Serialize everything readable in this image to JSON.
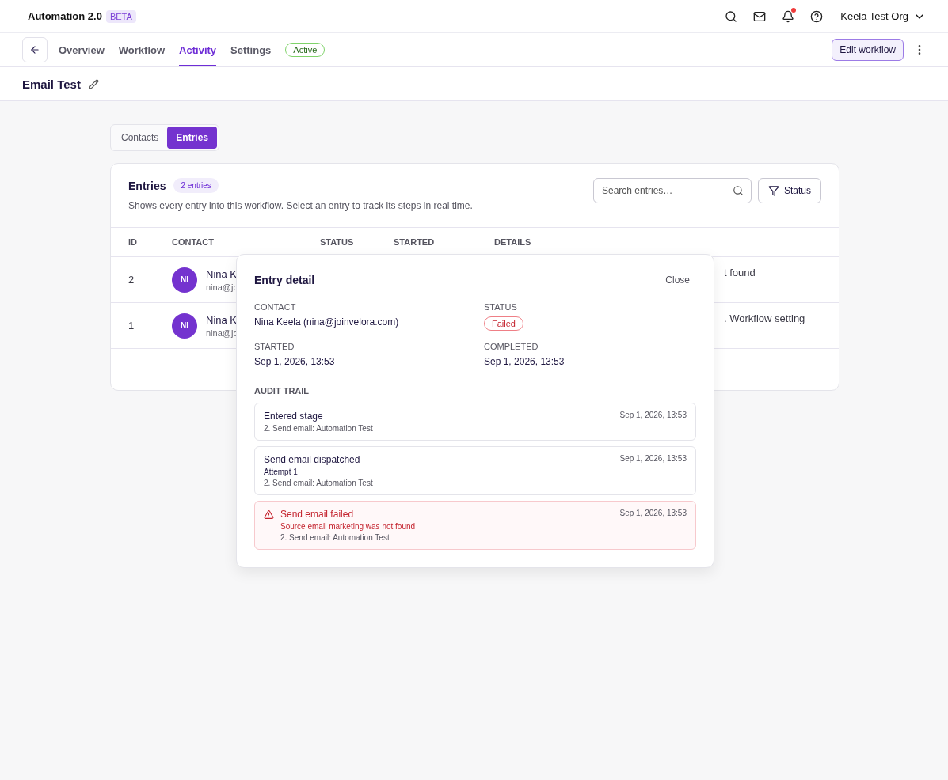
{
  "app": {
    "title": "Automation 2.0",
    "badge": "BETA",
    "org": "Keela Test Org",
    "has_notification": true
  },
  "nav": {
    "tabs": [
      {
        "label": "Overview",
        "selected": false
      },
      {
        "label": "Workflow",
        "selected": false
      },
      {
        "label": "Activity",
        "selected": true
      },
      {
        "label": "Settings",
        "selected": false
      }
    ],
    "status": "Active",
    "edit_button": "Edit workflow"
  },
  "page_title": "Email Test",
  "segments": [
    {
      "label": "Contacts",
      "selected": false
    },
    {
      "label": "Entries",
      "selected": true
    }
  ],
  "entries": {
    "title": "Entries",
    "count": "2 entries",
    "description": "Shows every entry into this workflow. Select an entry to track its steps in real time.",
    "search": {
      "placeholder": "Search entries…"
    },
    "filter_button": "Status",
    "columns": [
      "ID",
      "CONTACT",
      "STATUS",
      "STARTED",
      "DETAILS"
    ],
    "rows": [
      {
        "id": "2",
        "initials": "NI",
        "name": "Nina K",
        "email": "nina@jo",
        "details": "t found"
      },
      {
        "id": "1",
        "initials": "NI",
        "name": "Nina K",
        "email": "nina@jo",
        "details": ". Workflow setting"
      }
    ]
  },
  "modal": {
    "title": "Entry detail",
    "close": "Close",
    "fields": [
      {
        "label": "CONTACT",
        "value": "Nina Keela (nina@joinvelora.com)",
        "kind": "text"
      },
      {
        "label": "STATUS",
        "value": "Failed",
        "kind": "badge"
      },
      {
        "label": "STARTED",
        "value": "Sep 1, 2026, 13:53",
        "kind": "text"
      },
      {
        "label": "COMPLETED",
        "value": "Sep 1, 2026, 13:53",
        "kind": "text"
      }
    ],
    "audit_title": "AUDIT TRAIL",
    "audit": [
      {
        "kind": "info",
        "title": "Entered stage",
        "time": "Sep 1, 2026, 13:53",
        "step": "2. Send email: Automation Test"
      },
      {
        "kind": "info",
        "title": "Send email dispatched",
        "time": "Sep 1, 2026, 13:53",
        "lines": [
          "Attempt 1"
        ],
        "step": "2. Send email: Automation Test"
      },
      {
        "kind": "error",
        "title": "Send email failed",
        "time": "Sep 1, 2026, 13:53",
        "lines": [
          "Source email marketing was not found"
        ],
        "step": "2. Send email: Automation Test"
      }
    ]
  }
}
